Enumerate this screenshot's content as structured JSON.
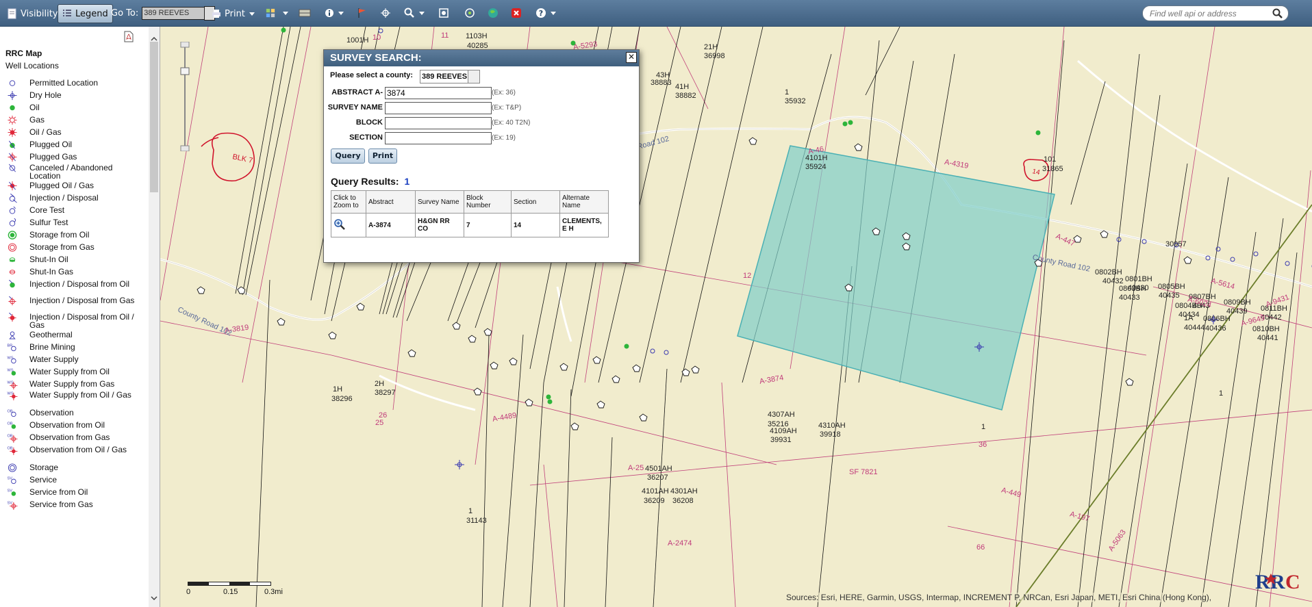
{
  "toolbar": {
    "visibility_label": "Visibility",
    "legend_label": "Legend",
    "goto_label": "Go To:",
    "goto_value": "389 REEVES",
    "print_label": "Print",
    "search_placeholder": "Find well api or address"
  },
  "legend": {
    "map_title": "RRC Map",
    "group_title": "Well Locations",
    "items": [
      {
        "label": "Permitted Location",
        "icon": "open-circle-icon"
      },
      {
        "label": "Dry Hole",
        "icon": "dry-hole-icon"
      },
      {
        "label": "Oil",
        "icon": "green-dot-icon"
      },
      {
        "label": "Gas",
        "icon": "gas-star-icon"
      },
      {
        "label": "Oil / Gas",
        "icon": "oil-gas-icon"
      },
      {
        "label": "Plugged Oil",
        "icon": "plugged-oil-icon"
      },
      {
        "label": "Plugged Gas",
        "icon": "plugged-gas-icon"
      },
      {
        "label": "Canceled / Abandoned Location",
        "icon": "canceled-location-icon"
      },
      {
        "label": "Plugged Oil / Gas",
        "icon": "plugged-oil-gas-icon"
      },
      {
        "label": "Injection / Disposal",
        "icon": "injection-icon"
      },
      {
        "label": "Core Test",
        "icon": "core-test-icon"
      },
      {
        "label": "Sulfur Test",
        "icon": "sulfur-test-icon"
      },
      {
        "label": "Storage from Oil",
        "icon": "storage-oil-icon"
      },
      {
        "label": "Storage from Gas",
        "icon": "storage-gas-icon"
      },
      {
        "label": "Shut-In Oil",
        "icon": "shut-in-oil-icon"
      },
      {
        "label": "Shut-In Gas",
        "icon": "shut-in-gas-icon"
      },
      {
        "label": "Injection / Disposal from Oil",
        "icon": "injection-oil-icon"
      },
      {
        "label": "Injection / Disposal from Gas",
        "icon": "injection-gas-icon"
      },
      {
        "label": "Injection / Disposal from Oil / Gas",
        "icon": "injection-oil-gas-icon"
      },
      {
        "label": "Geothermal",
        "icon": "geothermal-icon"
      },
      {
        "label": "Brine Mining",
        "icon": "brine-mining-icon"
      },
      {
        "label": "Water Supply",
        "icon": "water-supply-icon"
      },
      {
        "label": "Water Supply from Oil",
        "icon": "water-supply-oil-icon"
      },
      {
        "label": "Water Supply from Gas",
        "icon": "water-supply-gas-icon"
      },
      {
        "label": "Water Supply from Oil / Gas",
        "icon": "water-supply-oil-gas-icon"
      },
      {
        "label": "Observation",
        "icon": "observation-icon"
      },
      {
        "label": "Observation from Oil",
        "icon": "observation-oil-icon"
      },
      {
        "label": "Observation from Gas",
        "icon": "observation-gas-icon"
      },
      {
        "label": "Observation from Oil / Gas",
        "icon": "observation-oil-gas-icon"
      },
      {
        "label": "Storage",
        "icon": "storage-icon"
      },
      {
        "label": "Service",
        "icon": "service-icon"
      },
      {
        "label": "Service from Oil",
        "icon": "service-oil-icon"
      },
      {
        "label": "Service from Gas",
        "icon": "service-gas-icon"
      }
    ]
  },
  "dialog": {
    "title": "SURVEY SEARCH:",
    "county_prompt": "Please select a county:",
    "county_value": "389 REEVES",
    "fields": [
      {
        "label": "ABSTRACT A-",
        "value": "3874",
        "example": "(Ex: 36)"
      },
      {
        "label": "SURVEY NAME",
        "value": "",
        "example": "(Ex: T&P)"
      },
      {
        "label": "BLOCK",
        "value": "",
        "example": "(Ex: 40 T2N)"
      },
      {
        "label": "SECTION",
        "value": "",
        "example": "(Ex: 19)"
      }
    ],
    "query_button": "Query",
    "print_button": "Print",
    "results_label": "Query Results:",
    "results_count": "1",
    "columns": [
      "Click to Zoom to",
      "Abstract",
      "Survey Name",
      "Block Number",
      "Section",
      "Alternate Name"
    ],
    "rows": [
      {
        "abstract": "A-3874",
        "survey_name": "H&GN RR CO",
        "block": "7",
        "section": "14",
        "alternate": "CLEMENTS, E H"
      }
    ]
  },
  "map": {
    "annotations": {
      "blk": "BLK 7",
      "section": "14"
    },
    "highlight_color": "#7fcfc9",
    "well_labels": [
      "1001H",
      "1103H",
      "40285",
      "21H",
      "36998",
      "43H",
      "38883",
      "41H",
      "38882",
      "1",
      "35932",
      "4101H",
      "35924",
      "101",
      "31865",
      "30957",
      "0802BH",
      "40432",
      "0801BH",
      "40430",
      "0803BH",
      "40433",
      "0805BH",
      "40435",
      "0807BH",
      "4043",
      "0809BH",
      "40439",
      "0811BH",
      "40442",
      "0804BH",
      "40434",
      "1A",
      "40444",
      "0806BH",
      "40436",
      "0810BH",
      "40441",
      "1",
      "4307AH",
      "35216",
      "4109AH",
      "39931",
      "4310AH",
      "39918",
      "1",
      "4501AH",
      "36207",
      "4101AH",
      "36209",
      "4301AH",
      "36208",
      "1H",
      "38296",
      "2H",
      "38297",
      "1",
      "31143"
    ],
    "survey_labels": [
      "A-5293",
      "A-46",
      "A-4319",
      "A-447",
      "A-5614",
      "A-6024",
      "A-9431",
      "A-9649",
      "A-3819",
      "A-4489",
      "A-3874",
      "A-449",
      "A-197",
      "A-2474",
      "A-5063",
      "A-25",
      "12",
      "36",
      "66",
      "26",
      "25",
      "SF 7821",
      "10",
      "11"
    ],
    "road_labels": [
      "County Road 102",
      "Road 102",
      "County Road 102"
    ],
    "scale_labels": [
      "0",
      "0.15",
      "0.3mi"
    ],
    "attribution": "Sources: Esri, HERE, Garmin, USGS, Intermap, INCREMENT P, NRCan, Esri Japan, METI, Esri China (Hong Kong),"
  }
}
